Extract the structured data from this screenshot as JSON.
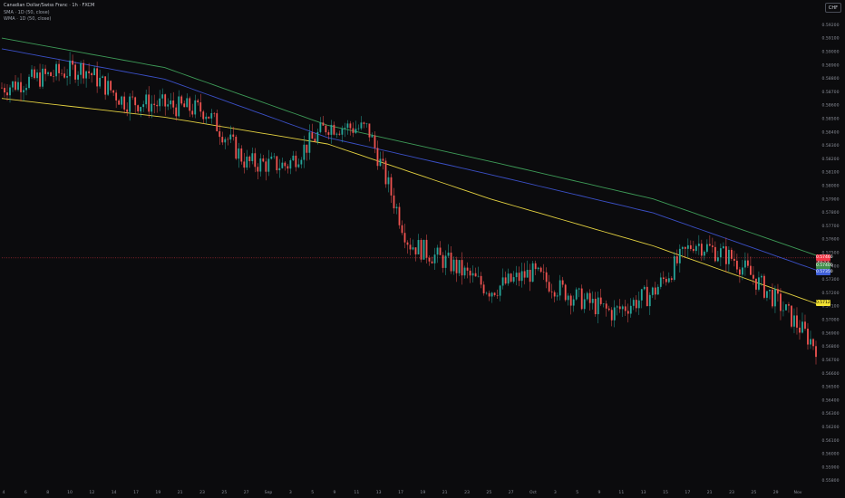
{
  "legend": {
    "title": "Canadian Dollar/Swiss Franc · 1h · FXCM",
    "sma": "SMA · 1D (50, close)",
    "wma": "WMA · 1D (50, close)"
  },
  "currency_label": "CHF",
  "price_tags": [
    {
      "value": "0.57460",
      "color": "#f23645",
      "text_color": "#ffffff",
      "price": 0.5746
    },
    {
      "value": "59:14",
      "color": "#7a2a31",
      "text_color": "#ffffff",
      "price": 0.57418
    },
    {
      "value": "0.57400",
      "color": "#3f8c4a",
      "text_color": "#ffffff",
      "price": 0.574
    },
    {
      "value": "0.57350",
      "color": "#3e5fd8",
      "text_color": "#ffffff",
      "price": 0.57352
    },
    {
      "value": "0.57125",
      "color": "#f2e133",
      "text_color": "#000000",
      "price": 0.57125
    }
  ],
  "chart_data": {
    "type": "line",
    "subtype": "candlestick",
    "ylim": [
      0.5575,
      0.5933
    ],
    "y_ticks": [
      "0.59200",
      "0.59100",
      "0.59000",
      "0.58900",
      "0.58800",
      "0.58700",
      "0.58600",
      "0.58500",
      "0.58400",
      "0.58300",
      "0.58200",
      "0.58100",
      "0.58000",
      "0.57900",
      "0.57800",
      "0.57700",
      "0.57600",
      "0.57500",
      "0.57400",
      "0.57300",
      "0.57200",
      "0.57100",
      "0.57000",
      "0.56900",
      "0.56800",
      "0.56700",
      "0.56600",
      "0.56500",
      "0.56400",
      "0.56300",
      "0.56200",
      "0.56100",
      "0.56000",
      "0.55900",
      "0.55800"
    ],
    "x_ticks": [
      "4",
      "6",
      "8",
      "10",
      "12",
      "14",
      "17",
      "19",
      "21",
      "23",
      "25",
      "27",
      "Sep",
      "3",
      "5",
      "9",
      "11",
      "13",
      "17",
      "19",
      "21",
      "23",
      "25",
      "27",
      "Oct",
      "3",
      "5",
      "9",
      "11",
      "13",
      "15",
      "17",
      "21",
      "23",
      "25",
      "29",
      "Nov"
    ],
    "current_price_line": 0.5746,
    "colors": {
      "up": "#26a69a",
      "down": "#ef5350",
      "sma": "#3d9a57",
      "wma": "#e2d040",
      "ma3": "#3a4fc4"
    },
    "series": [
      {
        "name": "close",
        "x": [
          0,
          5,
          10,
          15,
          20,
          25,
          30,
          35,
          40,
          45,
          50,
          55,
          60,
          65,
          70,
          75,
          80,
          85,
          90,
          95,
          100
        ],
        "values": [
          0.5873,
          0.5881,
          0.5888,
          0.5863,
          0.586,
          0.5856,
          0.5817,
          0.5815,
          0.5845,
          0.5842,
          0.5757,
          0.5742,
          0.5722,
          0.5735,
          0.5718,
          0.5705,
          0.572,
          0.5758,
          0.5745,
          0.5715,
          0.568
        ]
      },
      {
        "name": "SMA · 1D (50, close)",
        "x": [
          0,
          20,
          40,
          60,
          80,
          100
        ],
        "values": [
          0.591,
          0.5888,
          0.5845,
          0.5818,
          0.579,
          0.5748
        ]
      },
      {
        "name": "WMA · 1D (50, close)",
        "x": [
          0,
          20,
          40,
          60,
          80,
          100
        ],
        "values": [
          0.5865,
          0.5851,
          0.5831,
          0.579,
          0.5755,
          0.5712
        ]
      }
    ]
  }
}
